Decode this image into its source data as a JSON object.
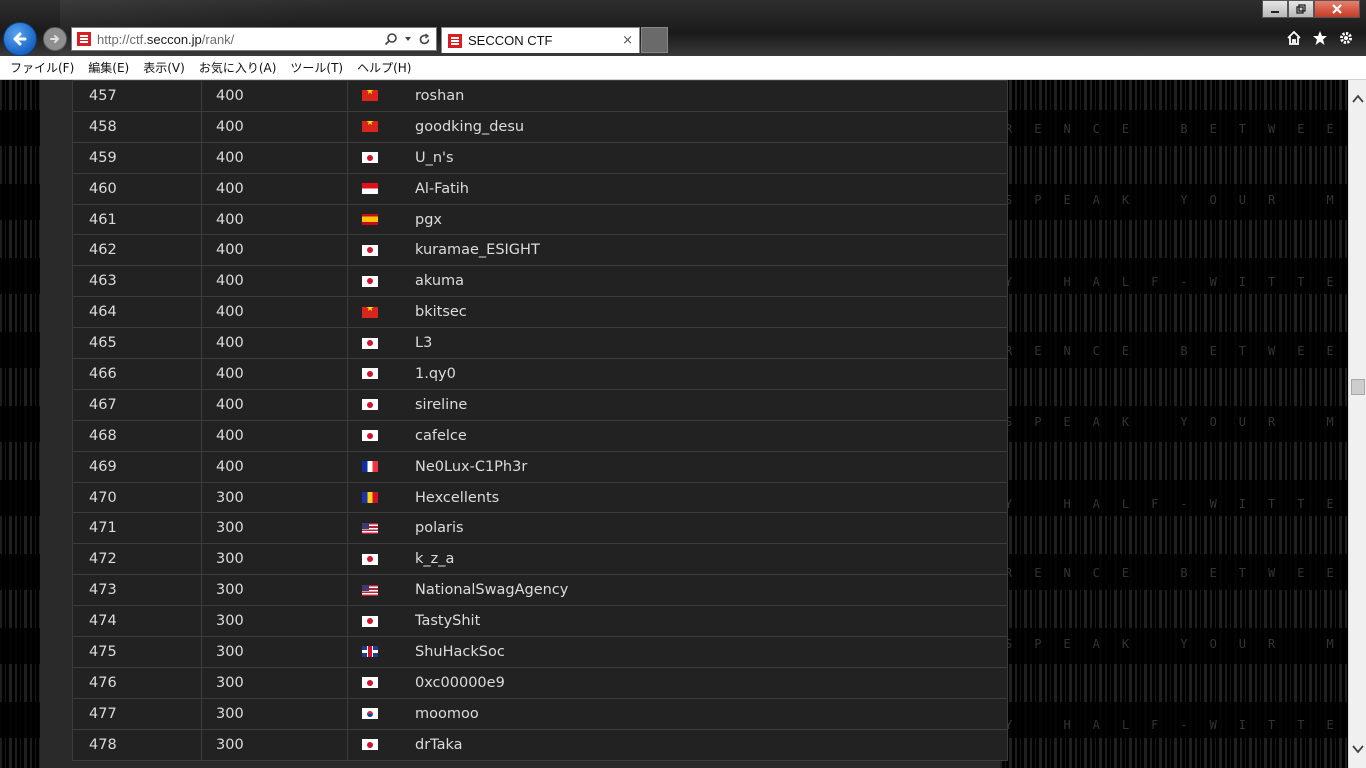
{
  "browser": {
    "url_prefix": "http://ctf.",
    "url_host": "seccon.jp",
    "url_path": "/rank/",
    "tab_title": "SECCON CTF",
    "tab_close": "×",
    "menu": [
      "ファイル(F)",
      "編集(E)",
      "表示(V)",
      "お気に入り(A)",
      "ツール(T)",
      "ヘルプ(H)"
    ]
  },
  "ranking": {
    "rows": [
      {
        "rank": "457",
        "score": "400",
        "flag": "vn",
        "team": "roshan"
      },
      {
        "rank": "458",
        "score": "400",
        "flag": "vn",
        "team": "goodking_desu"
      },
      {
        "rank": "459",
        "score": "400",
        "flag": "jp",
        "team": "U_n's"
      },
      {
        "rank": "460",
        "score": "400",
        "flag": "id",
        "team": "Al-Fatih"
      },
      {
        "rank": "461",
        "score": "400",
        "flag": "es",
        "team": "pgx"
      },
      {
        "rank": "462",
        "score": "400",
        "flag": "jp",
        "team": "kuramae_ESIGHT"
      },
      {
        "rank": "463",
        "score": "400",
        "flag": "jp",
        "team": "akuma"
      },
      {
        "rank": "464",
        "score": "400",
        "flag": "vn",
        "team": "bkitsec"
      },
      {
        "rank": "465",
        "score": "400",
        "flag": "jp",
        "team": "L3"
      },
      {
        "rank": "466",
        "score": "400",
        "flag": "jp",
        "team": "1.qy0"
      },
      {
        "rank": "467",
        "score": "400",
        "flag": "jp",
        "team": "sireline"
      },
      {
        "rank": "468",
        "score": "400",
        "flag": "jp",
        "team": "cafelce"
      },
      {
        "rank": "469",
        "score": "400",
        "flag": "fr",
        "team": "Ne0Lux-C1Ph3r"
      },
      {
        "rank": "470",
        "score": "300",
        "flag": "ro",
        "team": "Hexcellents"
      },
      {
        "rank": "471",
        "score": "300",
        "flag": "us",
        "team": "polaris"
      },
      {
        "rank": "472",
        "score": "300",
        "flag": "jp",
        "team": "k_z_a"
      },
      {
        "rank": "473",
        "score": "300",
        "flag": "us",
        "team": "NationalSwagAgency"
      },
      {
        "rank": "474",
        "score": "300",
        "flag": "jp",
        "team": "TastyShit"
      },
      {
        "rank": "475",
        "score": "300",
        "flag": "gb",
        "team": "ShuHackSoc"
      },
      {
        "rank": "476",
        "score": "300",
        "flag": "jp",
        "team": "0xc00000e9"
      },
      {
        "rank": "477",
        "score": "300",
        "flag": "kr",
        "team": "moomoo"
      },
      {
        "rank": "478",
        "score": "300",
        "flag": "jp",
        "team": "drTaka"
      }
    ]
  },
  "background_text": [
    "RENCE BETWEEN",
    "SPEAK YOUR M",
    "Y HALF-WITTE"
  ]
}
